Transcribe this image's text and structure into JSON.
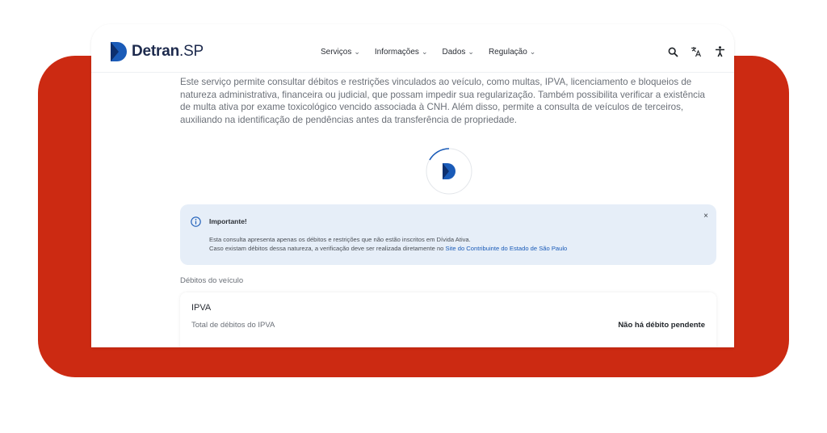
{
  "header": {
    "logo": {
      "part1": "Detran",
      "part2": ".SP"
    },
    "nav": [
      {
        "label": "Serviços"
      },
      {
        "label": "Informações"
      },
      {
        "label": "Dados"
      },
      {
        "label": "Regulação"
      }
    ],
    "icons": [
      "search-icon",
      "translate-icon",
      "accessibility-icon"
    ]
  },
  "main": {
    "description": "Este serviço permite consultar débitos e restrições vinculados ao veículo, como multas, IPVA, licenciamento e bloqueios de natureza administrativa, financeira ou judicial, que possam impedir sua regularização. Também possibilita verificar a existência de multa ativa por exame toxicológico vencido associada à CNH. Além disso, permite a consulta de veículos de terceiros, auxiliando na identificação de pendências antes da transferência de propriedade.",
    "alert": {
      "title": "Importante!",
      "close": "×",
      "line1": "Esta consulta apresenta apenas os débitos e restrições que não estão inscritos em Dívida Ativa.",
      "line2": "Caso existam débitos dessa natureza, a verificação deve ser realizada diretamente no ",
      "link": "Site do Contribuinte do Estado de São Paulo"
    },
    "section_title": "Débitos do veículo",
    "card": {
      "title": "IPVA",
      "label": "Total de débitos do IPVA",
      "status": "Não há débito pendente"
    }
  },
  "colors": {
    "accent_red": "#cc2a12",
    "brand_blue": "#1a5bb8",
    "alert_bg": "#e6eef8"
  }
}
